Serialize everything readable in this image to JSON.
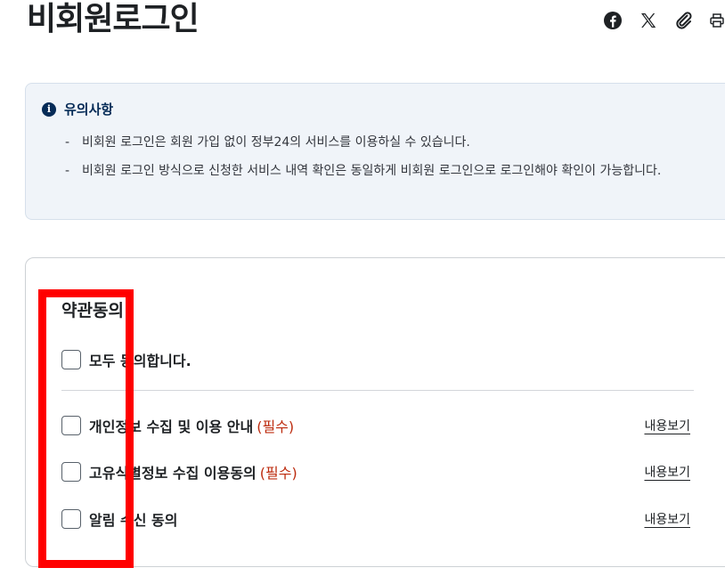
{
  "page": {
    "title": "비회원로그인"
  },
  "share": {
    "icons": [
      "facebook-icon",
      "x-icon",
      "link-icon",
      "print-icon"
    ]
  },
  "notice": {
    "title": "유의사항",
    "items": [
      "비회원 로그인은 회원 가입 없이 정부24의 서비스를 이용하실 수 있습니다.",
      "비회원 로그인 방식으로 신청한 서비스 내역 확인은 동일하게 비회원 로그인으로 로그인해야 확인이 가능합니다."
    ]
  },
  "terms": {
    "title": "약관동의",
    "all_agree": "모두 동의합니다.",
    "items": [
      {
        "label": "개인정보 수집 및 이용 안내",
        "tag": "(필수)",
        "link": "내용보기"
      },
      {
        "label": "고유식별정보 수집 이용동의",
        "tag": "(필수)",
        "link": "내용보기"
      },
      {
        "label": "알림 수신 동의",
        "tag": "",
        "link": "내용보기"
      }
    ]
  },
  "colors": {
    "required": "#bd2c0f",
    "notice_title": "#052b57",
    "highlight": "#ff0000"
  }
}
